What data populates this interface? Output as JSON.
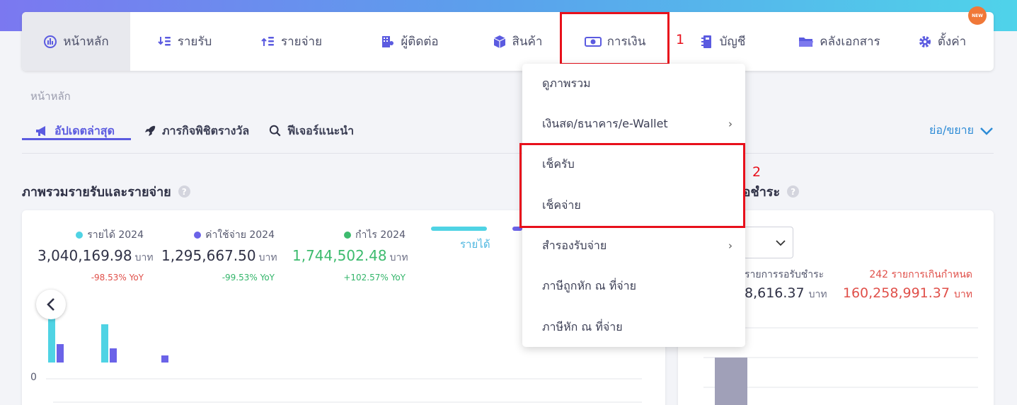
{
  "nav": {
    "items": [
      {
        "label": "หน้าหลัก",
        "icon": "dashboard-icon"
      },
      {
        "label": "รายรับ",
        "icon": "income-icon"
      },
      {
        "label": "รายจ่าย",
        "icon": "expense-icon"
      },
      {
        "label": "ผู้ติดต่อ",
        "icon": "contacts-icon"
      },
      {
        "label": "สินค้า",
        "icon": "product-box-icon"
      },
      {
        "label": "การเงิน",
        "icon": "money-icon"
      },
      {
        "label": "บัญชี",
        "icon": "accounting-book-icon"
      },
      {
        "label": "คลังเอกสาร",
        "icon": "folder-icon"
      },
      {
        "label": "ตั้งค่า",
        "icon": "gear-icon"
      }
    ],
    "new_badge": "NEW"
  },
  "annotations": {
    "one": "1",
    "two": "2"
  },
  "breadcrumb": "หน้าหลัก",
  "tabs": {
    "latest": "อัปเดตล่าสุด",
    "missions": "ภารกิจพิชิตรางวัล",
    "features": "ฟีเจอร์แนะนำ",
    "collapse": "ย่อ/ขยาย"
  },
  "overview": {
    "title": "ภาพรวมรายรับและรายจ่าย",
    "stats": [
      {
        "label": "รายได้ 2024",
        "value": "3,040,169.98",
        "unit": "บาท",
        "yoy": "-98.53% YoY",
        "dot": "#4fd3e4",
        "yoy_color": "#e0504a",
        "value_color": "#2f3146"
      },
      {
        "label": "ค่าใช้จ่าย 2024",
        "value": "1,295,667.50",
        "unit": "บาท",
        "yoy": "-99.53% YoY",
        "dot": "#6b63e8",
        "yoy_color": "#33b56a",
        "value_color": "#2f3146"
      },
      {
        "label": "กำไร 2024",
        "value": "1,744,502.48",
        "unit": "บาท",
        "yoy": "+102.57% YoY",
        "dot": "#3dbb6e",
        "yoy_color": "#33b56a",
        "value_color": "#3dbb6e"
      }
    ],
    "legend_income": "รายได้",
    "axis_zero": "0"
  },
  "receivable": {
    "title_partial": "รอชำระ",
    "pending_label": "รายการรอรับชำระ",
    "pending_value": "8,616.37",
    "overdue_label": "242 รายการเกินกำหนด",
    "overdue_value": "160,258,991.37",
    "unit": "บาท"
  },
  "dropdown": {
    "items": [
      {
        "label": "ดูภาพรวม",
        "submenu": false
      },
      {
        "label": "เงินสด/ธนาคาร/e-Wallet",
        "submenu": true
      },
      {
        "label": "เช็ครับ",
        "submenu": false
      },
      {
        "label": "เช็คจ่าย",
        "submenu": false
      },
      {
        "label": "สำรองรับจ่าย",
        "submenu": true
      },
      {
        "label": "ภาษีถูกหัก ณ ที่จ่าย",
        "submenu": false
      },
      {
        "label": "ภาษีหัก ณ ที่จ่าย",
        "submenu": false
      }
    ]
  },
  "colors": {
    "accent": "#5b5be0",
    "highlight": "#e8101b",
    "income": "#4fd3e4",
    "expense": "#6b63e8"
  }
}
